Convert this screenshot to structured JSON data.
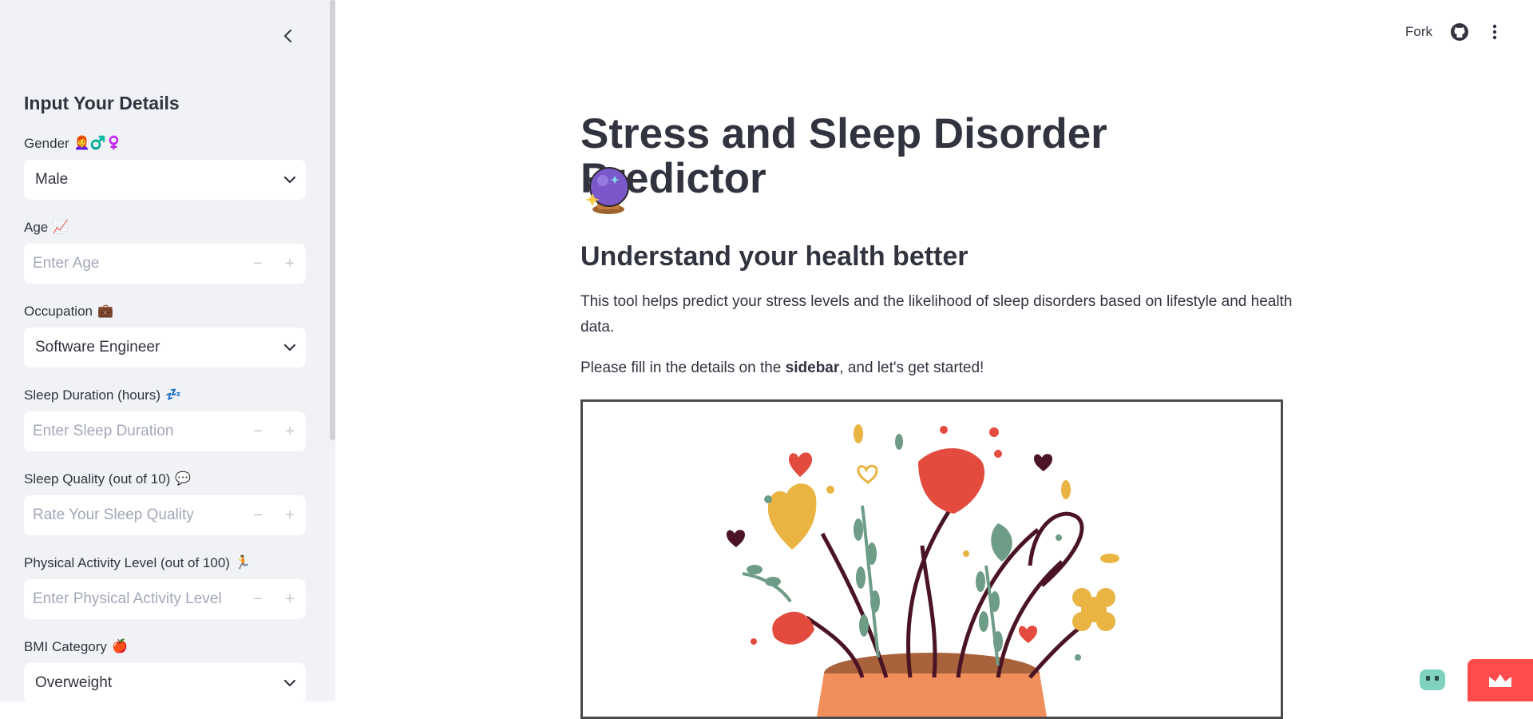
{
  "sidebar": {
    "title": "Input Your Details",
    "fields": {
      "gender": {
        "label": "Gender",
        "emoji": "👩‍🦰♂️♀️",
        "value": "Male"
      },
      "age": {
        "label": "Age",
        "emoji": "📈",
        "placeholder": "Enter Age"
      },
      "occupation": {
        "label": "Occupation",
        "emoji": "💼",
        "value": "Software Engineer"
      },
      "sleep_duration": {
        "label": "Sleep Duration (hours)",
        "emoji": "💤",
        "placeholder": "Enter Sleep Duration"
      },
      "sleep_quality": {
        "label": "Sleep Quality (out of 10)",
        "emoji": "💬",
        "placeholder": "Rate Your Sleep Quality"
      },
      "physical_activity": {
        "label": "Physical Activity Level (out of 100)",
        "emoji": "🏃",
        "placeholder": "Enter Physical Activity Level"
      },
      "bmi": {
        "label": "BMI Category",
        "emoji": "🍎",
        "value": "Overweight"
      }
    },
    "stepper": {
      "minus": "−",
      "plus": "+"
    }
  },
  "header": {
    "fork_label": "Fork"
  },
  "main": {
    "title": "Stress and Sleep Disorder Predictor",
    "subtitle": "Understand your health better",
    "description": "This tool helps predict your stress levels and the likelihood of sleep disorders based on lifestyle and health data.",
    "note_prefix": "Please fill in the details on the ",
    "note_bold": "sidebar",
    "note_suffix": ", and let's get started!"
  },
  "colors": {
    "sidebar_bg": "#f0f2f6",
    "accent": "#ff4b4b",
    "text": "#31333f",
    "placeholder": "#a3a8b8"
  },
  "icons": {
    "collapse": "chevron-left-icon",
    "select": "chevron-down-icon",
    "header_github": "github-icon",
    "header_menu": "more-vertical-icon",
    "bot": "bot-icon",
    "crown": "crown-icon"
  }
}
